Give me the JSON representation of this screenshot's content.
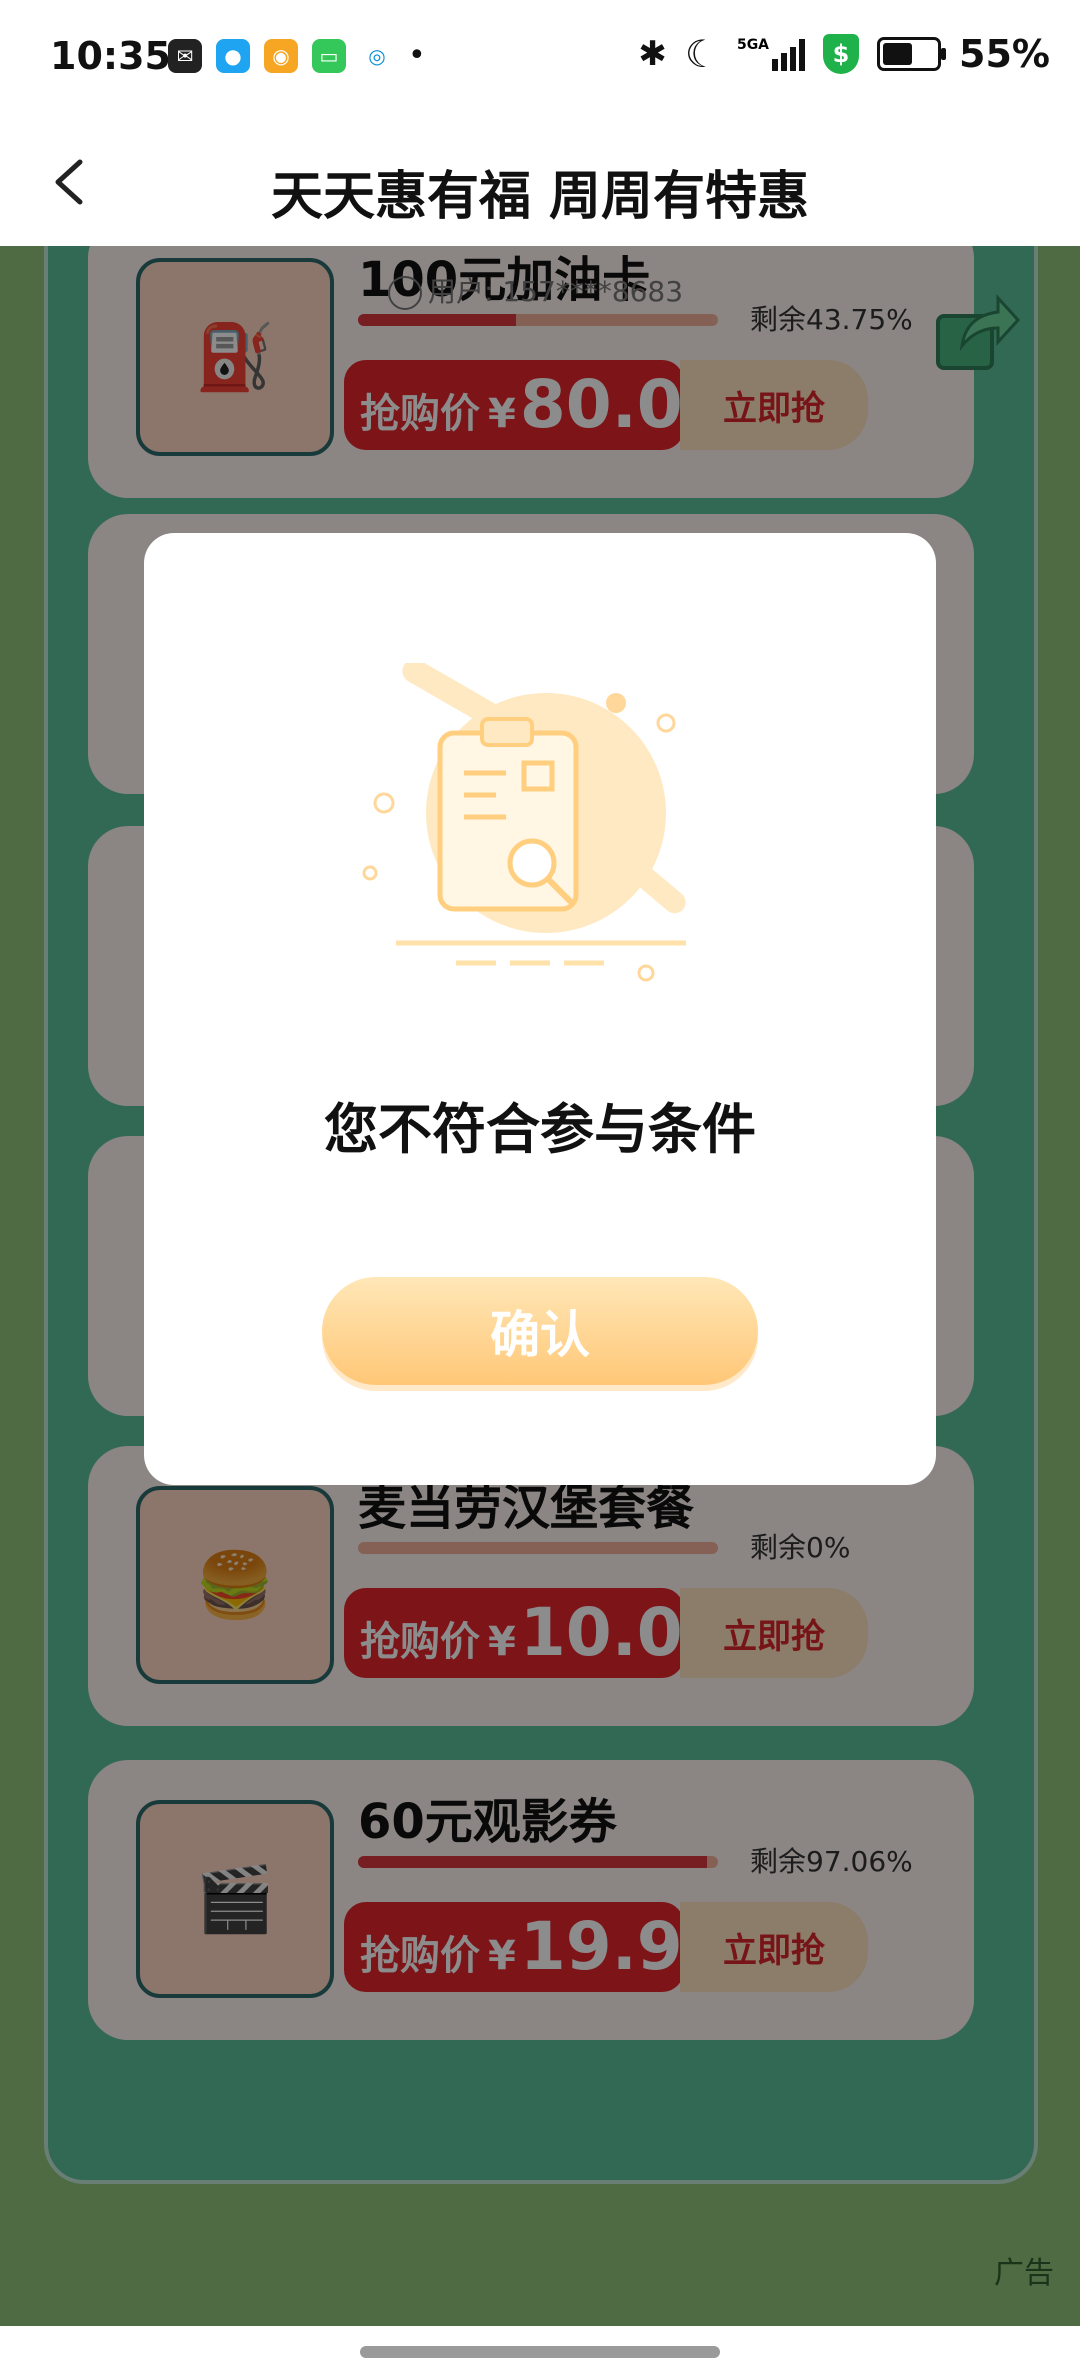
{
  "status_bar": {
    "time": "10:35",
    "network": "5GA",
    "battery_percent": "55%",
    "battery_level": 0.55,
    "app_icons": [
      "wechat-icon",
      "qq-icon",
      "weibo-icon",
      "messages-icon",
      "china-mobile-icon"
    ]
  },
  "header": {
    "title": "天天惠有福 周周有特惠",
    "back_icon": "chevron-left-icon"
  },
  "products": [
    {
      "name": "100元加油卡",
      "user": "用户: 157****8683",
      "remaining": "剩余43.75%",
      "remaining_ratio": 0.4375,
      "buy_label": "抢购价",
      "currency": "¥",
      "price": "80.0",
      "button": "立即抢"
    },
    {
      "name": "麦当劳汉堡套餐",
      "remaining": "剩余0%",
      "remaining_ratio": 0.0,
      "buy_label": "抢购价",
      "currency": "¥",
      "price": "10.0",
      "button": "立即抢"
    },
    {
      "name": "60元观影券",
      "remaining": "剩余97.06%",
      "remaining_ratio": 0.9706,
      "buy_label": "抢购价",
      "currency": "¥",
      "price": "19.9",
      "button": "立即抢"
    }
  ],
  "ad_label": "广告",
  "dialog": {
    "message": "您不符合参与条件",
    "confirm": "确认"
  },
  "colors": {
    "accent_red": "#e2262c",
    "page_green": "#8fc47b",
    "panel_teal": "#5bbf9b",
    "confirm_orange": "#ffc777"
  }
}
